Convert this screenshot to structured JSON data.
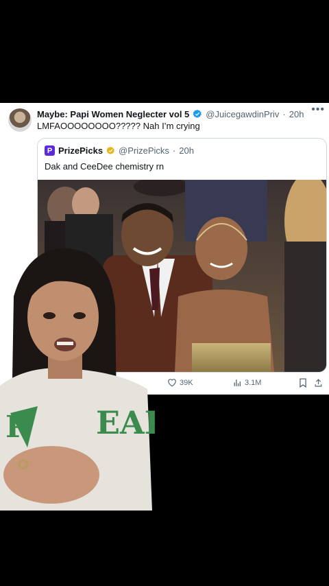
{
  "tweet": {
    "author_name": "Maybe: Papi Women Neglecter vol 5",
    "handle": "@JuicegawdinPriv",
    "time": "20h",
    "text": "LMFAOOOOOOOO????? Nah I’m crying",
    "more_icon": "more-horizontal-icon"
  },
  "quoted": {
    "logo_letter": "P",
    "author_name": "PrizePicks",
    "handle": "@PrizePicks",
    "time": "20h",
    "text": "Dak and CeeDee chemistry rn"
  },
  "actions": {
    "likes": "39K",
    "views": "3.1M"
  },
  "colors": {
    "verified_blue": "#1d9bf0",
    "verified_gold": "#e2b719",
    "prizepicks_purple": "#5b2bd9",
    "muted_text": "#536471"
  }
}
